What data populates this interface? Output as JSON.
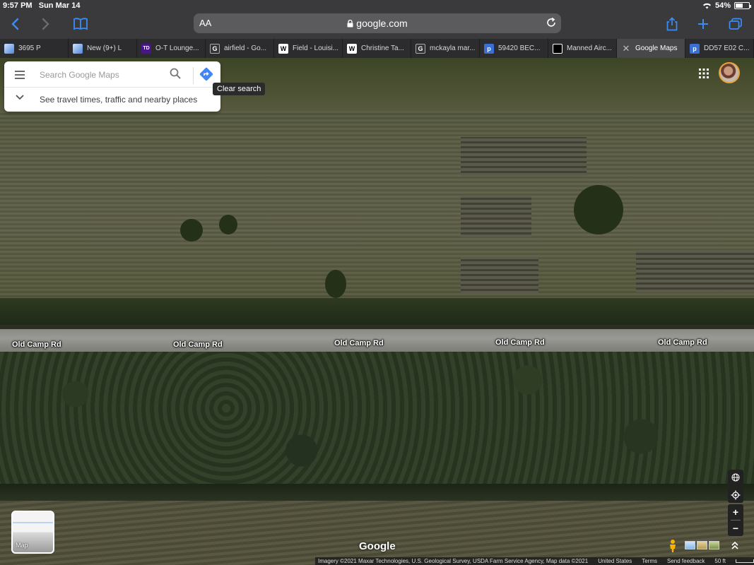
{
  "status": {
    "time": "9:57 PM",
    "date": "Sun Mar 14",
    "battery": "54%",
    "battery_level": 0.54
  },
  "browser": {
    "aa": "AA",
    "url": "google.com",
    "tabs": [
      {
        "label": "3695 P",
        "favicon": "image",
        "active": false
      },
      {
        "label": "New (9+) L",
        "favicon": "image",
        "active": false
      },
      {
        "label": "O-T Lounge...",
        "favicon": "TD",
        "active": false
      },
      {
        "label": "airfield - Go...",
        "favicon": "G",
        "active": false
      },
      {
        "label": "Field - Louisi...",
        "favicon": "W",
        "active": false
      },
      {
        "label": "Christine Ta...",
        "favicon": "W",
        "active": false
      },
      {
        "label": "mckayla mar...",
        "favicon": "G",
        "active": false
      },
      {
        "label": "59420 BEC...",
        "favicon": "P",
        "active": false
      },
      {
        "label": "Manned Airc...",
        "favicon": "black",
        "active": false
      },
      {
        "label": "Google Maps",
        "favicon": "close",
        "active": true
      },
      {
        "label": "DD57 E02 C...",
        "favicon": "P",
        "active": false
      }
    ]
  },
  "maps": {
    "search_placeholder": "Search Google Maps",
    "nearby_text": "See travel times, traffic and nearby places",
    "tooltip": "Clear search",
    "road_name": "Old Camp Rd",
    "road_labels": [
      "Old Camp Rd",
      "Old Camp Rd",
      "Old Camp Rd",
      "Old Camp Rd",
      "Old Camp Rd"
    ],
    "layer_label": "Map",
    "logo": "Google",
    "attribution": {
      "imagery": "Imagery ©2021 Maxar Technologies, U.S. Geological Survey, USDA Farm Service Agency, Map data ©2021",
      "country": "United States",
      "terms": "Terms",
      "feedback": "Send feedback",
      "scale": "50 ft"
    }
  },
  "colors": {
    "accent": "#4285f4",
    "browser_chrome": "#3a3a3c",
    "tab_strip": "#2c2c2e"
  }
}
